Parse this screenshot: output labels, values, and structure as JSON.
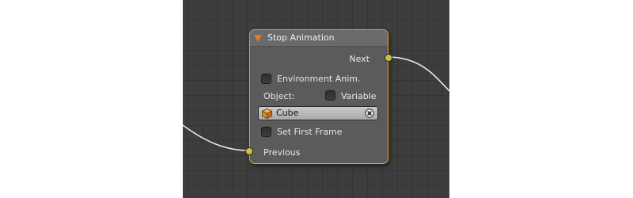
{
  "node": {
    "title": "Stop Animation",
    "accent_color": "#e2a23c",
    "socket_color": "#c8c23f",
    "output_label": "Next",
    "input_label": "Previous",
    "environment_anim": {
      "label": "Environment Anim.",
      "checked": false
    },
    "object_label": "Object:",
    "variable": {
      "label": "Variable",
      "checked": false
    },
    "object_field": {
      "value": "Cube",
      "icon": "cube-icon",
      "clear_icon": "clear-x-icon"
    },
    "set_first_frame": {
      "label": "Set First Frame",
      "checked": false
    }
  }
}
